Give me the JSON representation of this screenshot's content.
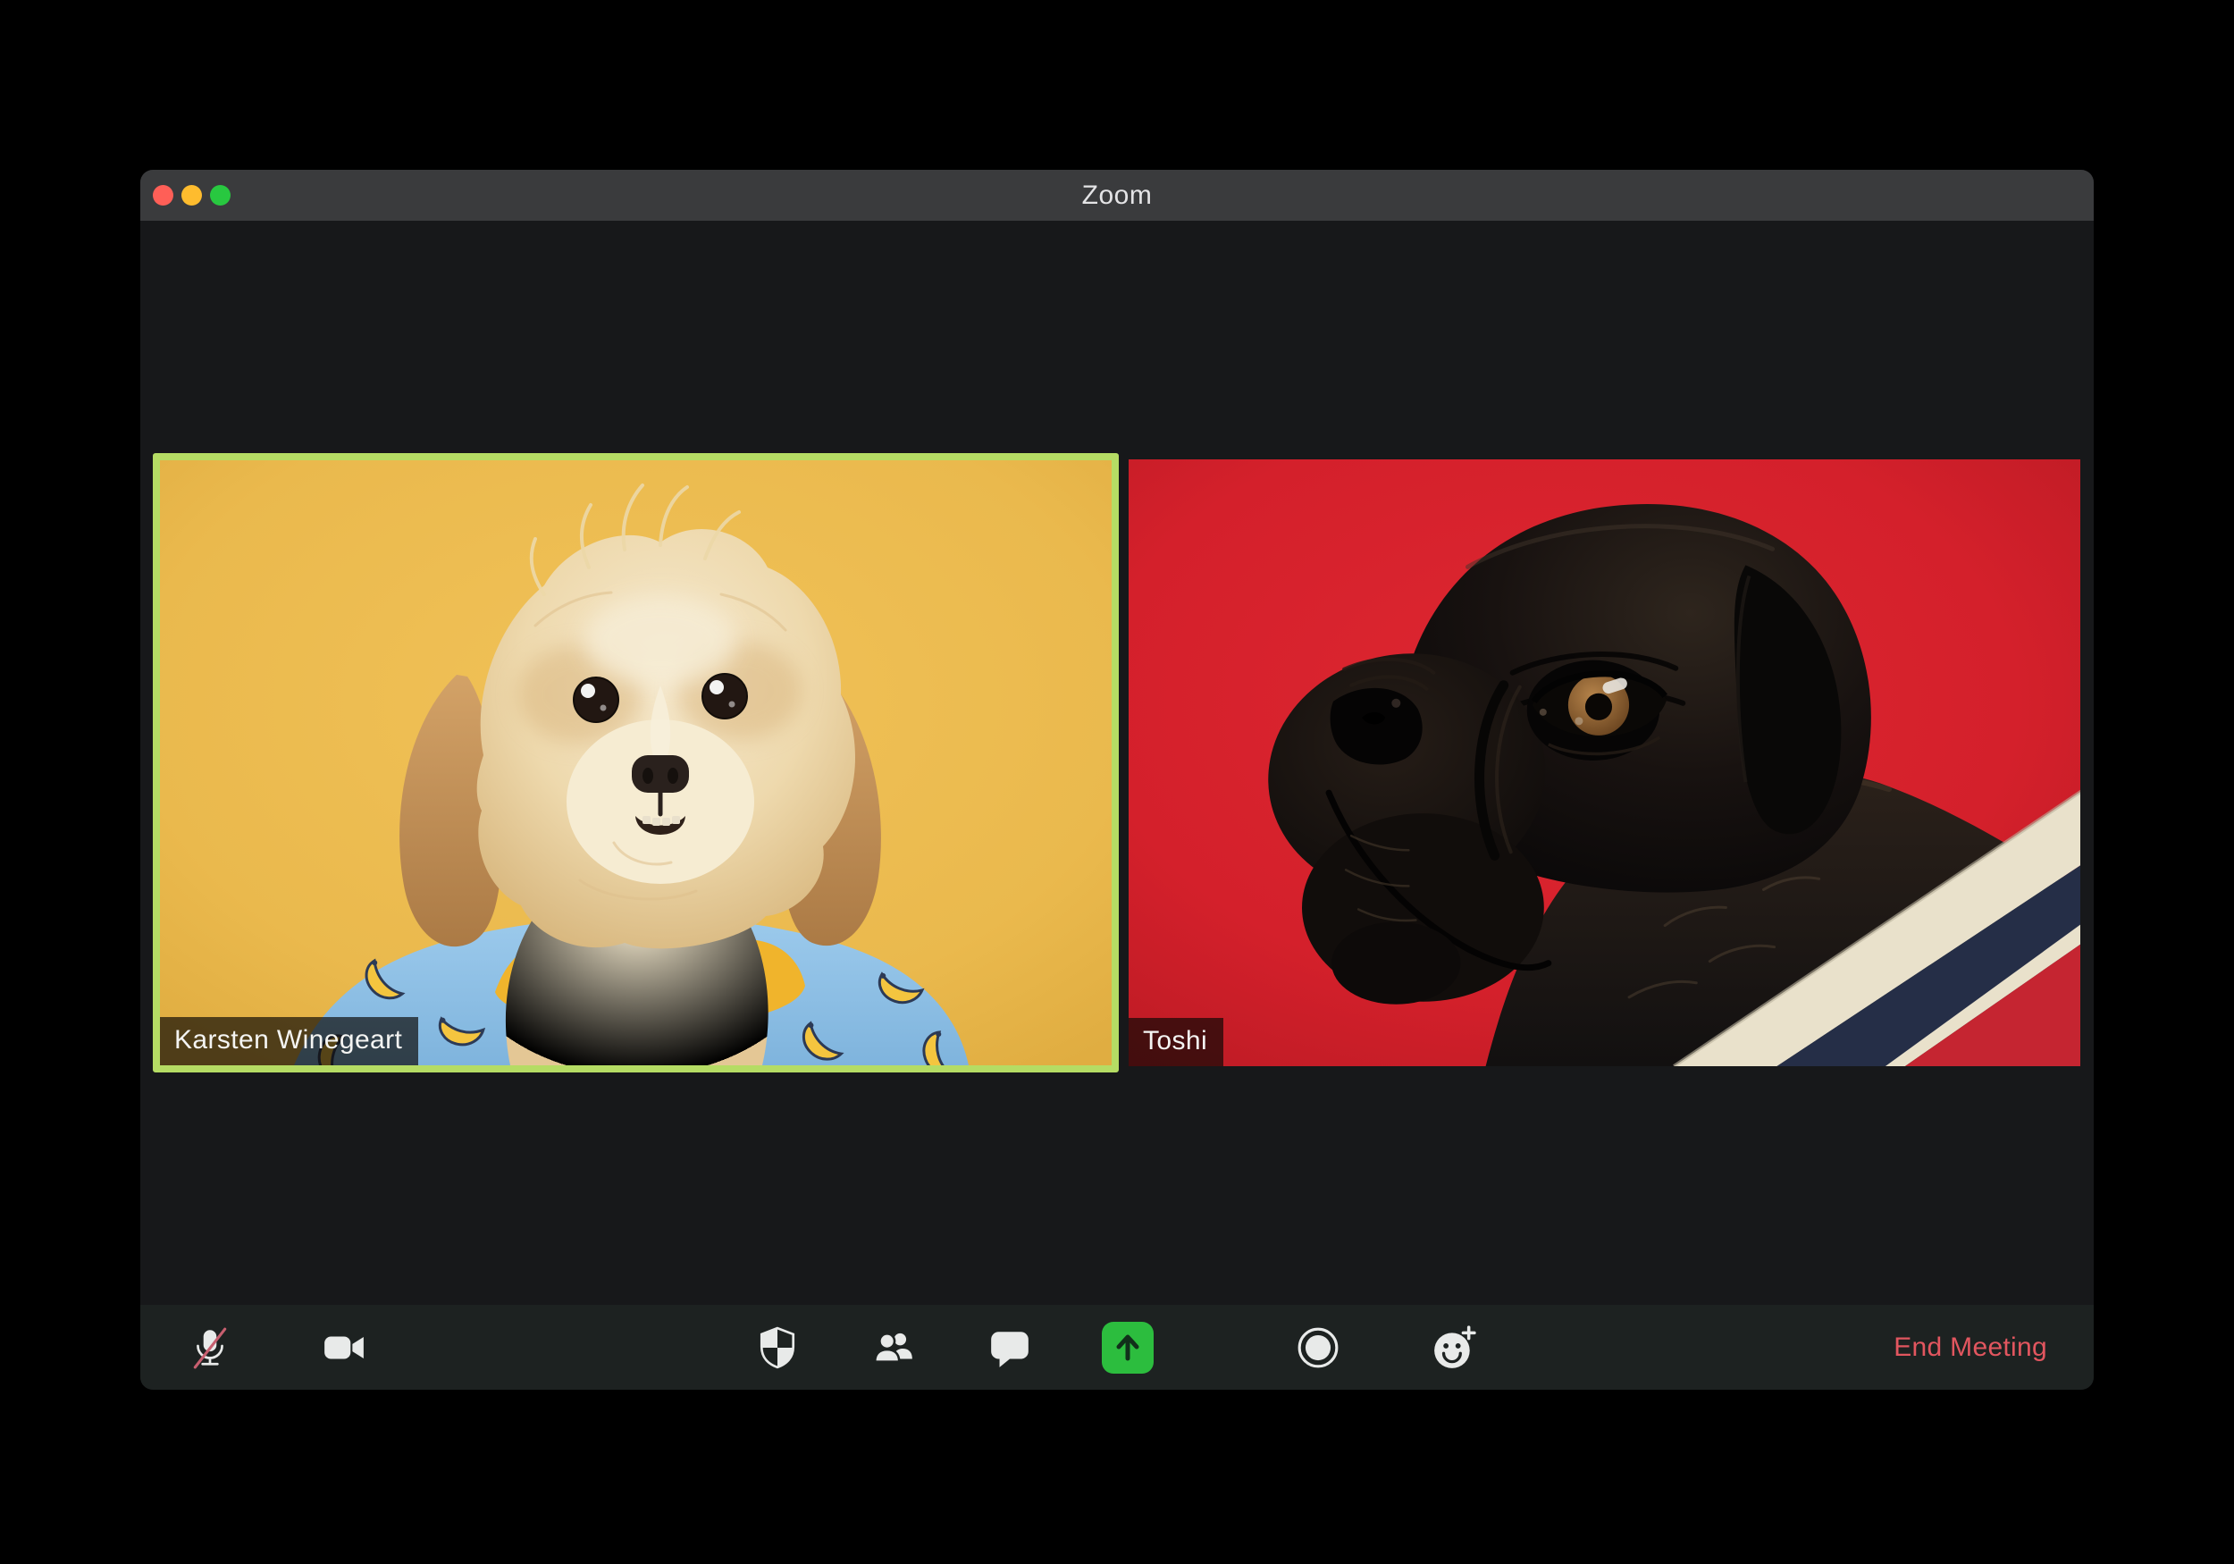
{
  "window": {
    "title": "Zoom"
  },
  "video_grid": {
    "participants": [
      {
        "name": "Karsten Winegeart",
        "active_speaker": true,
        "background_color": "#ecba4e",
        "subject": "cream fluffy dog wearing blue banana shirt on yellow background"
      },
      {
        "name": "Toshi",
        "active_speaker": false,
        "background_color": "#d7212c",
        "subject": "black pug in striped sweater on red background"
      }
    ]
  },
  "toolbar": {
    "buttons": [
      {
        "id": "mute",
        "icon": "microphone-off-icon",
        "state": "muted"
      },
      {
        "id": "video",
        "icon": "video-camera-icon"
      },
      {
        "id": "security",
        "icon": "shield-icon"
      },
      {
        "id": "participants",
        "icon": "participants-icon"
      },
      {
        "id": "chat",
        "icon": "chat-bubble-icon"
      },
      {
        "id": "share-screen",
        "icon": "share-screen-arrow-icon"
      },
      {
        "id": "record",
        "icon": "record-icon"
      },
      {
        "id": "reactions",
        "icon": "smiley-plus-icon"
      }
    ],
    "end_meeting_label": "End Meeting"
  },
  "colors": {
    "traffic_red": "#ff5f57",
    "traffic_yellow": "#febc2e",
    "traffic_green": "#28c840",
    "titlebar_bg": "#3a3b3d",
    "content_bg": "#17181a",
    "toolbar_bg": "#1d2221",
    "active_speaker_border": "#b5dc64",
    "share_accent": "#2cbd3e",
    "end_meeting_red": "#e2565f",
    "mic_muted_slash": "#c75f6f",
    "tile_yellow": "#ecba4e",
    "tile_red": "#d7212c"
  }
}
